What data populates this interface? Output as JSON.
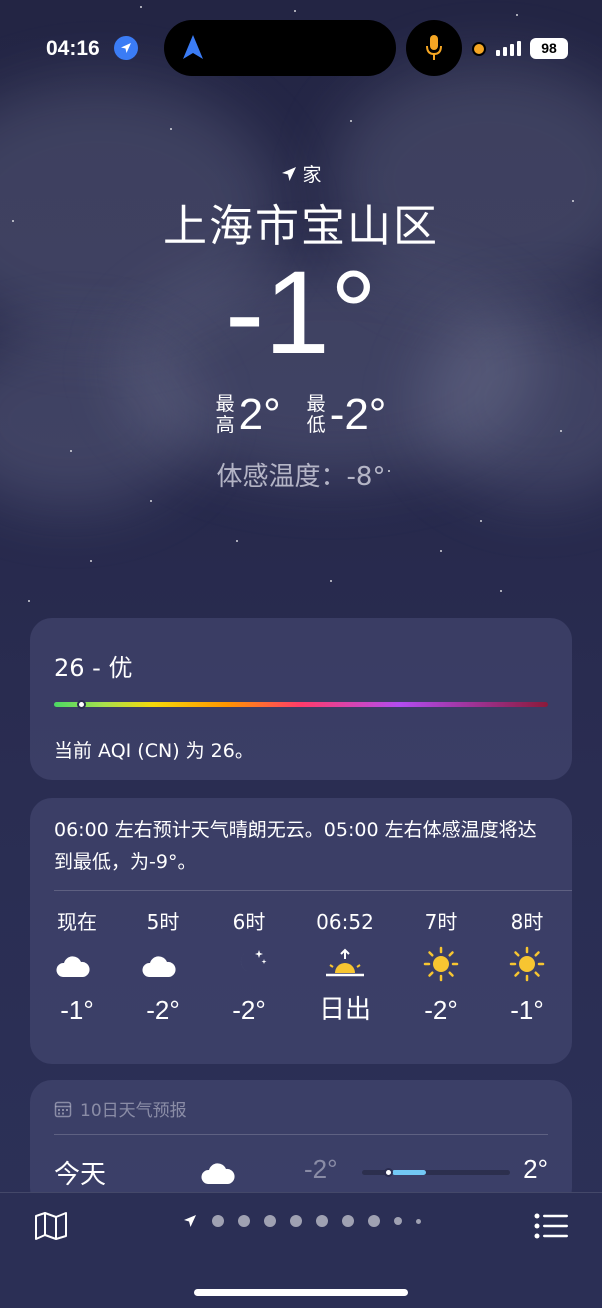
{
  "status_bar": {
    "time": "04:16",
    "battery": "98"
  },
  "header": {
    "location_tag": "家",
    "city": "上海市宝山区",
    "current_temp": "-1°",
    "high_label": [
      "最",
      "高"
    ],
    "high": "2°",
    "low_label": [
      "最",
      "低"
    ],
    "low": "-2°",
    "feels_like": "体感温度：-8°"
  },
  "aqi": {
    "title": "26 - 优",
    "description": "当前 AQI (CN) 为 26。",
    "value": 26
  },
  "hourly": {
    "summary": "06:00 左右预计天气晴朗无云。05:00 左右体感温度将达到最低，为-9°。",
    "items": [
      {
        "label": "现在",
        "icon": "partly-cloudy-night-icon",
        "temp": "-1°"
      },
      {
        "label": "5时",
        "icon": "partly-cloudy-night-icon",
        "temp": "-2°"
      },
      {
        "label": "6时",
        "icon": "moon-stars-icon",
        "temp": "-2°"
      },
      {
        "label": "06:52",
        "icon": "sunrise-icon",
        "temp": "日出"
      },
      {
        "label": "7时",
        "icon": "sun-icon",
        "temp": "-2°"
      },
      {
        "label": "8时",
        "icon": "sun-icon",
        "temp": "-1°"
      }
    ]
  },
  "forecast": {
    "header": "10日天气预报",
    "rows": [
      {
        "day": "今天",
        "icon": "partly-cloudy-night-icon",
        "low": "-2°",
        "high": "2°"
      }
    ]
  },
  "colors": {
    "aqi_marker": "#ffffff",
    "forecast_range": "#72c8f5",
    "sun": "#f7c531"
  }
}
